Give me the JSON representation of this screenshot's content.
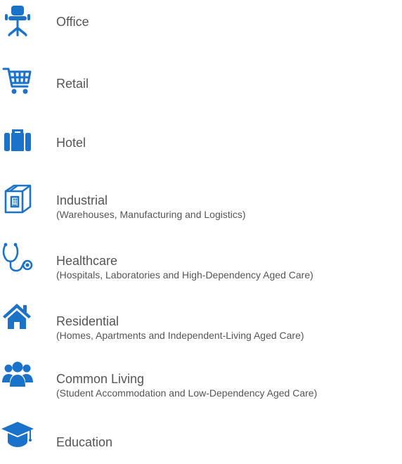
{
  "accent_color": "#1a73c9",
  "sectors": [
    {
      "icon": "office-chair-icon",
      "title": "Office",
      "subtitle": ""
    },
    {
      "icon": "shopping-cart-icon",
      "title": "Retail",
      "subtitle": ""
    },
    {
      "icon": "suitcase-icon",
      "title": "Hotel",
      "subtitle": ""
    },
    {
      "icon": "package-box-icon",
      "title": "Industrial",
      "subtitle": "(Warehouses, Manufacturing and Logistics)"
    },
    {
      "icon": "stethoscope-icon",
      "title": "Healthcare",
      "subtitle": "(Hospitals, Laboratories and High-Dependency Aged Care)"
    },
    {
      "icon": "house-icon",
      "title": "Residential",
      "subtitle": "(Homes, Apartments and Independent-Living Aged Care)"
    },
    {
      "icon": "users-group-icon",
      "title": "Common Living",
      "subtitle": "(Student Accommodation and Low-Dependency Aged Care)"
    },
    {
      "icon": "graduation-cap-icon",
      "title": "Education",
      "subtitle": ""
    }
  ]
}
